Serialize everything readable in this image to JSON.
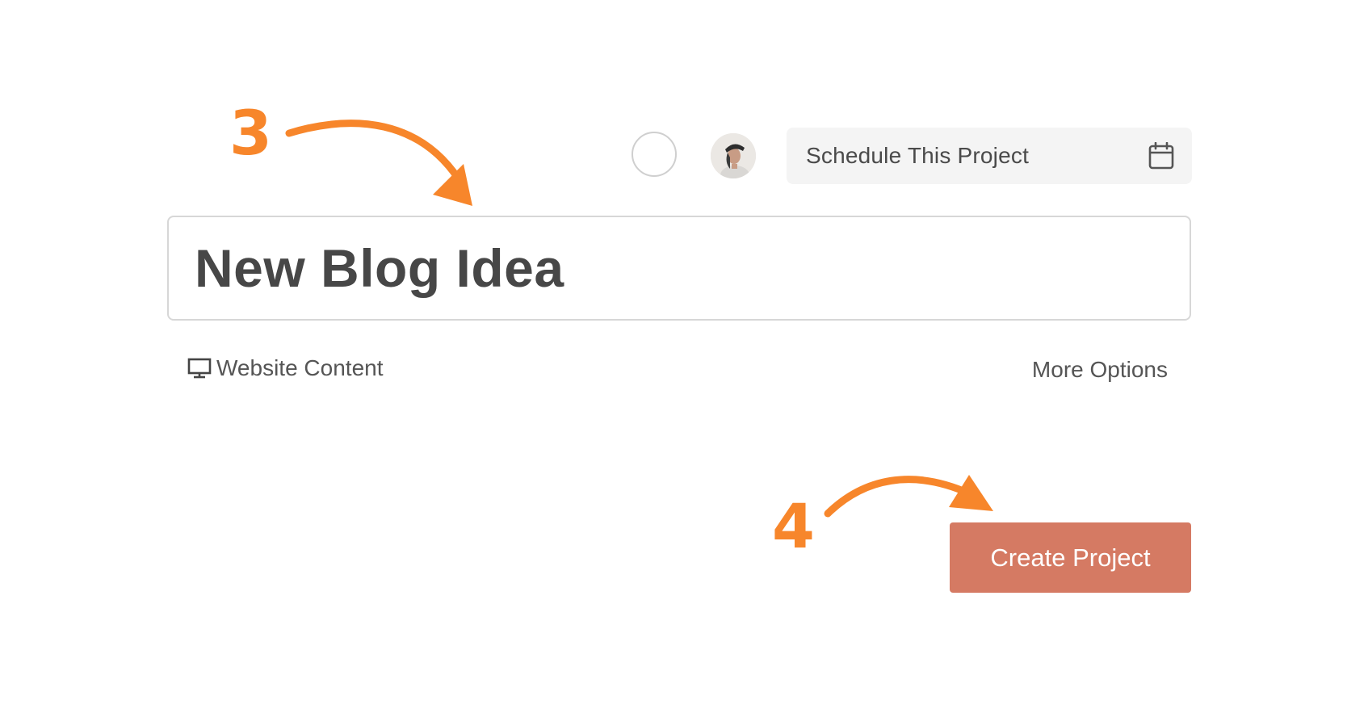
{
  "annotations": {
    "step_3": "3",
    "step_4": "4",
    "color": "#f7862b"
  },
  "header": {
    "schedule_label": "Schedule This Project",
    "schedule_icon": "calendar-icon",
    "status_icon": "empty-circle",
    "avatar_icon": "user-avatar"
  },
  "project": {
    "title": "New Blog Idea",
    "category_icon": "monitor-icon",
    "category_label": "Website Content",
    "more_options_label": "More Options"
  },
  "actions": {
    "create_label": "Create Project",
    "create_color": "#d57a63"
  }
}
